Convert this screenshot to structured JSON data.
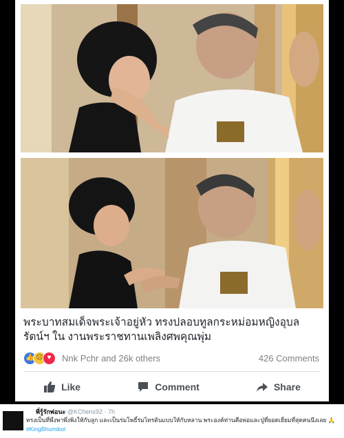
{
  "post": {
    "caption": "พระบาทสมเด็จพระเจ้าอยู่หัว ทรงปลอบทูลกระหม่อมหญิงอุบลรัตน์ฯ ใน งานพระราชทานเพลิงศพคุณพุ่ม",
    "reactions": {
      "icons": [
        "like-icon",
        "sad-icon",
        "love-icon"
      ],
      "names": "Nnk Pchr and 26k others",
      "comments": "426 Comments"
    },
    "actions": {
      "like": "Like",
      "comment": "Comment",
      "share": "Share"
    }
  },
  "tweet": {
    "name": "พี่รู้รักพ่อนะ",
    "handle": "@KChenx92 · 7h",
    "text": "ทรงเป็นที่พึ่งพาพึ่งพิงให้กับลูก และเป็นร่มโพธิ์ร่มไทรต้นแบบให้กับหลาน พระองค์ท่านคือพ่อและปู่ที่ยอดเยี่ยมที่สุดคนนึงเลย 🙏",
    "hashtag": "#KingBhumibol"
  },
  "colors": {
    "accent": "#3b78e7",
    "love": "#f0284a",
    "sad": "#f5c33b",
    "hashtag": "#1da1f2"
  }
}
